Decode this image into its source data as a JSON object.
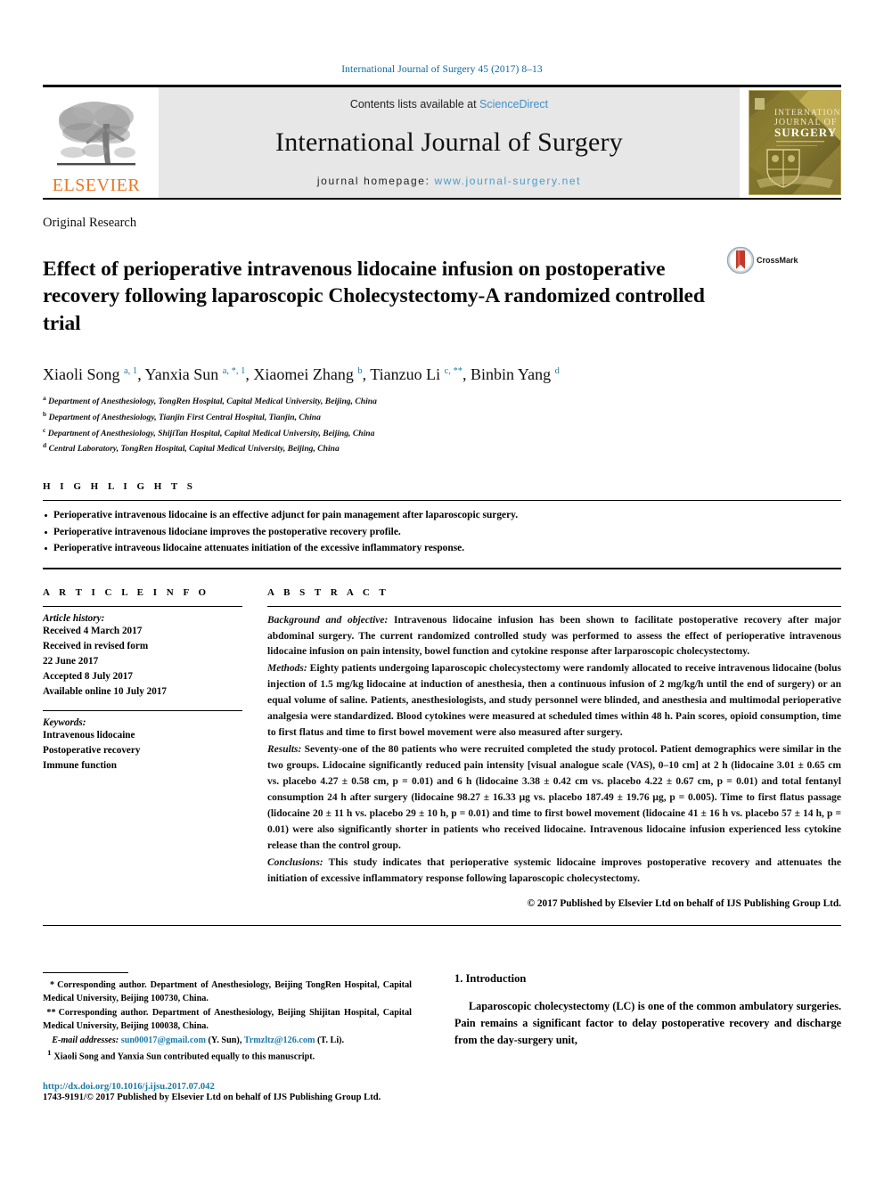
{
  "running_head": "International Journal of Surgery 45 (2017) 8–13",
  "masthead": {
    "contents_prefix": "Contents lists available at ",
    "contents_link": "ScienceDirect",
    "journal_name": "International Journal of Surgery",
    "homepage_prefix": "journal homepage: ",
    "homepage_url": "www.journal-surgery.net",
    "publisher_wordmark": "ELSEVIER",
    "publisher_logo_icon": "elsevier-tree-icon",
    "cover_title_line1": "INTERNATIONAL",
    "cover_title_line2": "JOURNAL OF",
    "cover_title_line3": "SURGERY"
  },
  "colors": {
    "running_head_blue": "#0b6aa2",
    "sciencedirect_blue": "#3f91c9",
    "homepage_blue": "#4a9cc7",
    "link_blue": "#1b7aa8",
    "elsevier_orange": "#E87722",
    "masthead_grey": "#e7e7e7",
    "cover_gold": "#b2942f"
  },
  "article": {
    "type": "Original Research",
    "title": "Effect of perioperative intravenous lidocaine infusion on postoperative recovery following laparoscopic Cholecystectomy-A randomized controlled trial",
    "crossmark_label": "CrossMark",
    "authors_html": "Xiaoli Song <sup>a, 1</sup>, Yanxia Sun <sup>a, *, 1</sup>, Xiaomei Zhang <sup>b</sup>, Tianzuo Li <sup>c, **</sup>, Binbin Yang <sup>d</sup>",
    "affiliations": [
      {
        "mark": "a",
        "text": "Department of Anesthesiology, TongRen Hospital, Capital Medical University, Beijing, China"
      },
      {
        "mark": "b",
        "text": "Department of Anesthesiology, Tianjin First Central Hospital, Tianjin, China"
      },
      {
        "mark": "c",
        "text": "Department of Anesthesiology, ShijiTan Hospital, Capital Medical University, Beijing, China"
      },
      {
        "mark": "d",
        "text": "Central Laboratory, TongRen Hospital, Capital Medical University, Beijing, China"
      }
    ]
  },
  "highlights": {
    "heading": "H I G H L I G H T S",
    "items": [
      "Perioperative intravenous lidocaine is an effective adjunct for pain management after laparoscopic surgery.",
      "Perioperative intravenous lidociane improves the postoperative recovery profile.",
      "Perioperative intraveous lidocaine attenuates initiation of the excessive inflammatory response."
    ]
  },
  "article_info": {
    "heading": "A R T I C L E   I N F O",
    "history_label": "Article history:",
    "history": [
      "Received 4 March 2017",
      "Received in revised form",
      "22 June 2017",
      "Accepted 8 July 2017",
      "Available online 10 July 2017"
    ],
    "keywords_label": "Keywords:",
    "keywords": [
      "Intravenous lidocaine",
      "Postoperative recovery",
      "Immune function"
    ]
  },
  "abstract": {
    "heading": "A B S T R A C T",
    "sections": [
      {
        "label": "Background and objective:",
        "text": " Intravenous lidocaine infusion has been shown to facilitate postoperative recovery after major abdominal surgery. The current randomized controlled study was performed to assess the effect of perioperative intravenous lidocaine infusion on pain intensity, bowel function and cytokine response after larparoscopic cholecystectomy."
      },
      {
        "label": "Methods:",
        "text": " Eighty patients undergoing laparoscopic cholecystectomy were randomly allocated to receive intravenous lidocaine (bolus injection of 1.5 mg/kg lidocaine at induction of anesthesia, then a continuous infusion of 2 mg/kg/h until the end of surgery) or an equal volume of saline. Patients, anesthesiologists, and study personnel were blinded, and anesthesia and multimodal perioperative analgesia were standardized. Blood cytokines were measured at scheduled times within 48 h. Pain scores, opioid consumption, time to first flatus and time to first bowel movement were also measured after surgery."
      },
      {
        "label": "Results:",
        "text": " Seventy-one of the 80 patients who were recruited completed the study protocol. Patient demographics were similar in the two groups. Lidocaine significantly reduced pain intensity [visual analogue scale (VAS), 0–10 cm] at 2 h (lidocaine 3.01 ± 0.65 cm vs. placebo 4.27 ± 0.58 cm, p = 0.01) and 6 h (lidocaine 3.38 ± 0.42 cm vs. placebo 4.22 ± 0.67 cm, p = 0.01) and total fentanyl consumption 24 h after surgery (lidocaine 98.27 ± 16.33 μg vs. placebo 187.49 ± 19.76 μg, p = 0.005). Time to first flatus passage (lidocaine 20 ± 11 h vs. placebo 29 ± 10 h, p = 0.01) and time to first bowel movement (lidocaine 41 ± 16 h vs. placebo 57 ± 14 h, p = 0.01) were also significantly shorter in patients who received lidocaine. Intravenous lidocaine infusion experienced less cytokine release than the control group."
      },
      {
        "label": "Conclusions:",
        "text": " This study indicates that perioperative systemic lidocaine improves postoperative recovery and attenuates the initiation of excessive inflammatory response following laparoscopic cholecystectomy."
      }
    ],
    "copyright": "© 2017 Published by Elsevier Ltd on behalf of IJS Publishing Group Ltd."
  },
  "footnotes": {
    "corresponding_1": "Corresponding author. Department of Anesthesiology, Beijing TongRen Hospital, Capital Medical University, Beijing 100730, China.",
    "corresponding_1_mark": "*",
    "corresponding_2": "Corresponding author. Department of Anesthesiology, Beijing Shijitan Hospital, Capital Medical University, Beijing 100038, China.",
    "corresponding_2_mark": "**",
    "email_label": "E-mail addresses:",
    "email_1": "sun00017@gmail.com",
    "email_1_owner": "(Y. Sun)",
    "email_2": "Trmzltz@126.com",
    "email_2_owner": "(T. Li).",
    "equal_contrib_mark": "1",
    "equal_contrib": "Xiaoli Song and Yanxia Sun contributed equally to this manuscript.",
    "doi": "http://dx.doi.org/10.1016/j.ijsu.2017.07.042",
    "issn_line": "1743-9191/© 2017 Published by Elsevier Ltd on behalf of IJS Publishing Group Ltd."
  },
  "introduction": {
    "heading": "1. Introduction",
    "paragraph": "Laparoscopic cholecystectomy (LC) is one of the common ambulatory surgeries. Pain remains a significant factor to delay postoperative recovery and discharge from the day-surgery unit,"
  }
}
